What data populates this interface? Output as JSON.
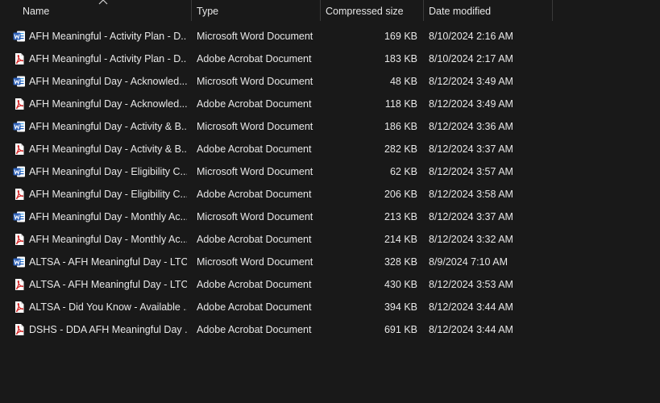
{
  "columns": {
    "name": "Name",
    "type": "Type",
    "size": "Compressed size",
    "date": "Date modified"
  },
  "sort": {
    "column": "name",
    "icon": "sort-up-chevron-icon"
  },
  "colors": {
    "background": "#191919",
    "text": "#e8e8e8",
    "word_blue": "#2b5fb8",
    "pdf_red": "#d32222"
  },
  "files": [
    {
      "name": "AFH Meaningful - Activity Plan - D...",
      "type": "Microsoft Word Document",
      "size": "169 KB",
      "date": "8/10/2024 2:16 AM",
      "icon": "word-document-icon"
    },
    {
      "name": "AFH Meaningful - Activity Plan - D...",
      "type": "Adobe Acrobat Document",
      "size": "183 KB",
      "date": "8/10/2024 2:17 AM",
      "icon": "pdf-document-icon"
    },
    {
      "name": "AFH Meaningful Day - Acknowled...",
      "type": "Microsoft Word Document",
      "size": "48 KB",
      "date": "8/12/2024 3:49 AM",
      "icon": "word-document-icon"
    },
    {
      "name": "AFH Meaningful Day - Acknowled...",
      "type": "Adobe Acrobat Document",
      "size": "118 KB",
      "date": "8/12/2024 3:49 AM",
      "icon": "pdf-document-icon"
    },
    {
      "name": "AFH Meaningful Day - Activity & B...",
      "type": "Microsoft Word Document",
      "size": "186 KB",
      "date": "8/12/2024 3:36 AM",
      "icon": "word-document-icon"
    },
    {
      "name": "AFH Meaningful Day - Activity & B...",
      "type": "Adobe Acrobat Document",
      "size": "282 KB",
      "date": "8/12/2024 3:37 AM",
      "icon": "pdf-document-icon"
    },
    {
      "name": "AFH Meaningful Day - Eligibility C...",
      "type": "Microsoft Word Document",
      "size": "62 KB",
      "date": "8/12/2024 3:57 AM",
      "icon": "word-document-icon"
    },
    {
      "name": "AFH Meaningful Day - Eligibility C...",
      "type": "Adobe Acrobat Document",
      "size": "206 KB",
      "date": "8/12/2024 3:58 AM",
      "icon": "pdf-document-icon"
    },
    {
      "name": "AFH Meaningful Day - Monthly Ac...",
      "type": "Microsoft Word Document",
      "size": "213 KB",
      "date": "8/12/2024 3:37 AM",
      "icon": "word-document-icon"
    },
    {
      "name": "AFH Meaningful Day - Monthly Ac...",
      "type": "Adobe Acrobat Document",
      "size": "214 KB",
      "date": "8/12/2024 3:32 AM",
      "icon": "pdf-document-icon"
    },
    {
      "name": "ALTSA - AFH Meaningful Day - LTC...",
      "type": "Microsoft Word Document",
      "size": "328 KB",
      "date": "8/9/2024 7:10 AM",
      "icon": "word-document-icon"
    },
    {
      "name": "ALTSA - AFH Meaningful Day - LTC...",
      "type": "Adobe Acrobat Document",
      "size": "430 KB",
      "date": "8/12/2024 3:53 AM",
      "icon": "pdf-document-icon"
    },
    {
      "name": "ALTSA - Did You Know - Available ...",
      "type": "Adobe Acrobat Document",
      "size": "394 KB",
      "date": "8/12/2024 3:44 AM",
      "icon": "pdf-document-icon"
    },
    {
      "name": "DSHS - DDA AFH Meaningful Day ...",
      "type": "Adobe Acrobat Document",
      "size": "691 KB",
      "date": "8/12/2024 3:44 AM",
      "icon": "pdf-document-icon"
    }
  ]
}
